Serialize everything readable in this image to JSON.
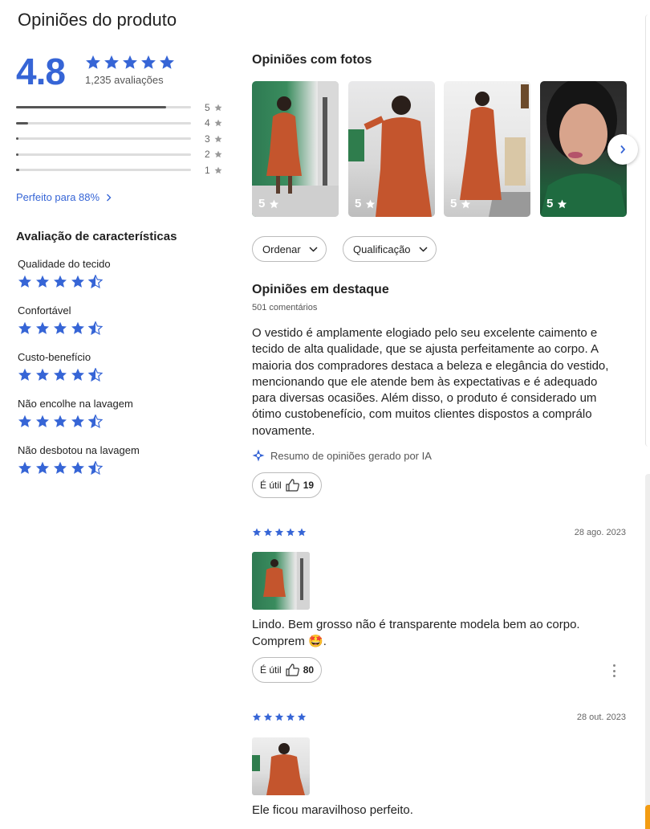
{
  "title": "Opiniões do produto",
  "summary_rating": {
    "score": "4.8",
    "stars": 5,
    "count_label": "1,235 avaliações"
  },
  "distribution": [
    {
      "label": "5",
      "fraction": 0.86
    },
    {
      "label": "4",
      "fraction": 0.07
    },
    {
      "label": "3",
      "fraction": 0.01
    },
    {
      "label": "2",
      "fraction": 0.005
    },
    {
      "label": "1",
      "fraction": 0.02
    }
  ],
  "perfect_label": "Perfeito para 88%",
  "features_title": "Avaliação de características",
  "features": [
    {
      "name": "Qualidade do tecido",
      "rating": 4.5
    },
    {
      "name": "Confortável",
      "rating": 4.5
    },
    {
      "name": "Custo-benefício",
      "rating": 4.5
    },
    {
      "name": "Não encolhe na lavagem",
      "rating": 4.5
    },
    {
      "name": "Não desbotou na lavagem",
      "rating": 4.5
    }
  ],
  "photos": {
    "title": "Opiniões com fotos",
    "items": [
      {
        "rating": "5"
      },
      {
        "rating": "5"
      },
      {
        "rating": "5"
      },
      {
        "rating": "5"
      }
    ]
  },
  "filters": {
    "sort_label": "Ordenar",
    "rating_label": "Qualificação"
  },
  "highlight": {
    "title": "Opiniões em destaque",
    "comment_count": "501 comentários",
    "summary": "O vestido é amplamente elogiado pelo seu excelente caimento e tecido de alta qualidade, que se ajusta perfeitamente ao corpo. A maioria dos compradores destaca a beleza e elegância do vestido, mencionando que ele atende bem às expectativas e é adequado para diversas ocasiões. Além disso, o produto é considerado um ótimo custobenefício, com muitos clientes dispostos a comprálo novamente.",
    "ai_note": "Resumo de opiniões gerado por IA",
    "useful_label": "É útil",
    "useful_count": "19"
  },
  "reviews": [
    {
      "stars": 5,
      "date": "28 ago. 2023",
      "text": "Lindo. Bem grosso não é transparente modela bem ao corpo. Comprem",
      "emoji": "🤩",
      "text_end": ".",
      "useful_label": "É útil",
      "useful_count": "80"
    },
    {
      "stars": 5,
      "date": "28 out. 2023",
      "text": "Ele ficou maravilhoso perfeito."
    }
  ],
  "colors": {
    "accent": "#3665d6",
    "star": "#3665d6",
    "text": "#222222",
    "dress": "#c4552d",
    "scroll_accent": "#f39c12"
  }
}
